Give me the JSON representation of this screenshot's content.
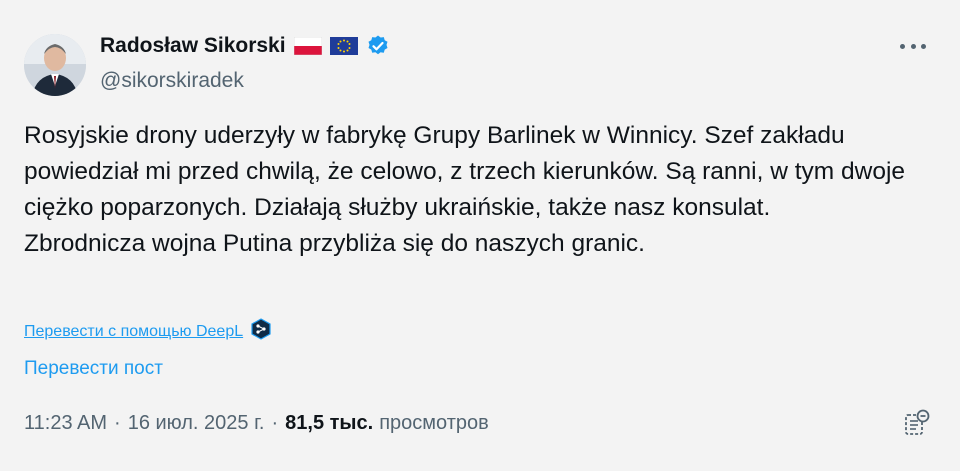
{
  "author": {
    "name": "Radosław Sikorski",
    "handle": "@sikorskiradek",
    "flags": [
      "poland-flag-icon",
      "eu-flag-icon"
    ],
    "verified_icon": "verified-badge-icon"
  },
  "tweet": {
    "paragraphs": [
      "Rosyjskie drony uderzyły w fabrykę Grupy Barlinek w Winnicy. Szef zakładu powiedział mi przed chwilą, że celowo, z trzech kierunków. Są ranni, w tym dwoje ciężko poparzonych. Działają służby ukraińskie, także nasz konsulat.",
      "Zbrodnicza wojna Putina przybliża się do naszych granic."
    ]
  },
  "actions": {
    "deepl_label": "Перевести с помощью DeepL",
    "translate_label": "Перевести пост"
  },
  "meta": {
    "time": "11:23 AM",
    "date": "16 июл. 2025 г.",
    "views_count": "81,5 тыс.",
    "views_label": "просмотров",
    "separator": "·"
  },
  "colors": {
    "link": "#1d9bf0",
    "secondary": "#536471",
    "primary_text": "#0f1419",
    "background": "#f3f3f3"
  }
}
